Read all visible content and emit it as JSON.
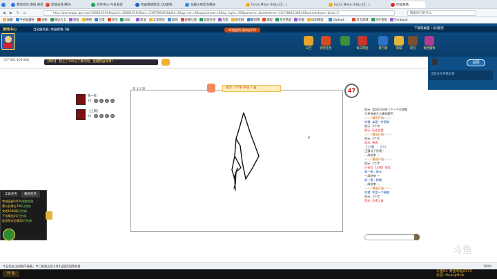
{
  "browser": {
    "tabs": [
      {
        "label": "我的首页 搜狗 视频门户",
        "fav": "#2b7de1"
      },
      {
        "label": "星期五我 腾讯",
        "fav": "#e24a2a"
      },
      {
        "label": "合作中心-今日发现",
        "fav": "#1aa35a"
      },
      {
        "label": "你画我猜游戏_QQ游戏",
        "fav": "#1d60c2"
      },
      {
        "label": "穿越火线官方网站",
        "fav": "#2c8ee0"
      },
      {
        "label": "Forza Milan (http://Z...)",
        "fav": "#f2b01e"
      },
      {
        "label": "Forza Milan (http://Z...)",
        "fav": "#f2b01e"
      },
      {
        "label": "你画我猜",
        "fav": "#e02a2a"
      }
    ],
    "address": "http://gameapp.qq.com/1006191949appid=1006191949uin=2367563658pfid=2&qz_ver=6&appcanvas=0&qz_style=35&params=&entertime=1617881138610&canvastype=&via=C",
    "search_placeholder": "搜索你们的什么"
  },
  "bookmarks": [
    "收藏",
    "手机收藏夹",
    "谷歌",
    "网址大全",
    "游戏",
    "购物",
    "百度",
    "淘宝",
    "360",
    "新浪",
    "工作网页",
    "新闻",
    "去哪儿网",
    "国美在线",
    "凡客",
    "易车网",
    "聚划算",
    "携程",
    "淘宝特卖",
    "天猫",
    "0DN博客",
    "Outlook",
    "京东商城",
    "苏宁易购",
    "Thinkpad"
  ],
  "game": {
    "center_title": "游戏中心",
    "breadcrumb": "当前服务器: 你画我猜-1服",
    "notice": "4月组团写  福利送不停",
    "login": "下载到桌面 / QQ服务",
    "top_icons": [
      {
        "label": "公告",
        "color": "#e6a52a"
      },
      {
        "label": "领奖任务",
        "color": "#d84b20"
      },
      {
        "label": "",
        "color": "#3b8f3b"
      },
      {
        "label": "每日奖励",
        "color": "#c8352c"
      },
      {
        "label": "排行榜",
        "color": "#2d72c4"
      },
      {
        "label": "商城",
        "color": "#e2b43a"
      },
      {
        "label": "背包",
        "color": "#7a4f2e"
      },
      {
        "label": "角色服饰",
        "color": "#b43a8d"
      }
    ],
    "room_info": "大厅-001-100-房间",
    "horn_msg": "【喇叭】  我上了300分了解冻啦，直播我画你猜?",
    "back_button": "返回",
    "right_search": "当前正在寻找玩家"
  },
  "drawing": {
    "round_label": "第 3/3 题",
    "hint": "提示: 2个字 字谜 7 画",
    "timer": "47"
  },
  "players": [
    {
      "name": "瓶一龟",
      "score": "30"
    },
    {
      "name": "【上锁】",
      "score": "20"
    }
  ],
  "chat": [
    {
      "text": "提示: 本局10分钟 1个一个可答题",
      "cls": ""
    },
    {
      "text": "可参答者大小事物题色",
      "cls": ""
    },
    {
      "text": "☆☆☆猜画开始☆☆☆",
      "cls": "c-org"
    },
    {
      "text": "你猜: 本是一件植物",
      "cls": "c-blue"
    },
    {
      "text": "提示: 3个字",
      "cls": ""
    },
    {
      "text": "提示: 历史名胜",
      "cls": "c-red"
    },
    {
      "text": "☆☆☆猜画开始☆☆☆",
      "cls": "c-org"
    },
    {
      "text": "提示: 2个字",
      "cls": ""
    },
    {
      "text": "提示: 钟表",
      "cls": "c-red"
    },
    {
      "text": "【上锁】 :  《人》",
      "cls": "c-blue"
    },
    {
      "text": "正猜对了答案~",
      "cls": ""
    },
    {
      "text": "一局结束 一",
      "cls": ""
    },
    {
      "text": "☆☆☆猜画开始☆☆☆",
      "cls": "c-org"
    },
    {
      "text": "提示: 2个字",
      "cls": ""
    },
    {
      "text": "已答对【上锁】答案",
      "cls": "c-red"
    },
    {
      "text": "瓶一龟 :  猴头",
      "cls": "c-blue"
    },
    {
      "text": "一局结束 一",
      "cls": ""
    },
    {
      "text": "瓶一龟 :  猪猪",
      "cls": "c-blue"
    },
    {
      "text": "一局结束 一",
      "cls": ""
    },
    {
      "text": "☆☆☆猜画开始☆☆☆",
      "cls": "c-org"
    },
    {
      "text": "你猜: 本是一个植物",
      "cls": "c-blue"
    },
    {
      "text": "提示: 3个字",
      "cls": ""
    },
    {
      "text": "提示: 交通工具",
      "cls": "c-red"
    }
  ],
  "left_panel": {
    "tabs": [
      "工具任务",
      "每日任务"
    ],
    "items": [
      {
        "text": "完成画图100%",
        "tag": "领取奖励"
      },
      {
        "text": "累计获得分700",
        "tag": "已完成"
      },
      {
        "text": "完成1000局",
        "tag": "已完成"
      },
      {
        "text": "下次猜出10",
        "tag": "已完成"
      },
      {
        "text": "连续答对正确10",
        "tag": "已完成"
      }
    ]
  },
  "statusbar": {
    "left": "今日优选   这部剧不能看，专门来毁三观    4月8日截至股票收盘",
    "right": "100%"
  },
  "watermark": {
    "line1": "斗鱼ID",
    "line2": "黄金鸡翅2173",
    "line3": "抖音: HuangHulk",
    "taskbar": "开 始"
  }
}
